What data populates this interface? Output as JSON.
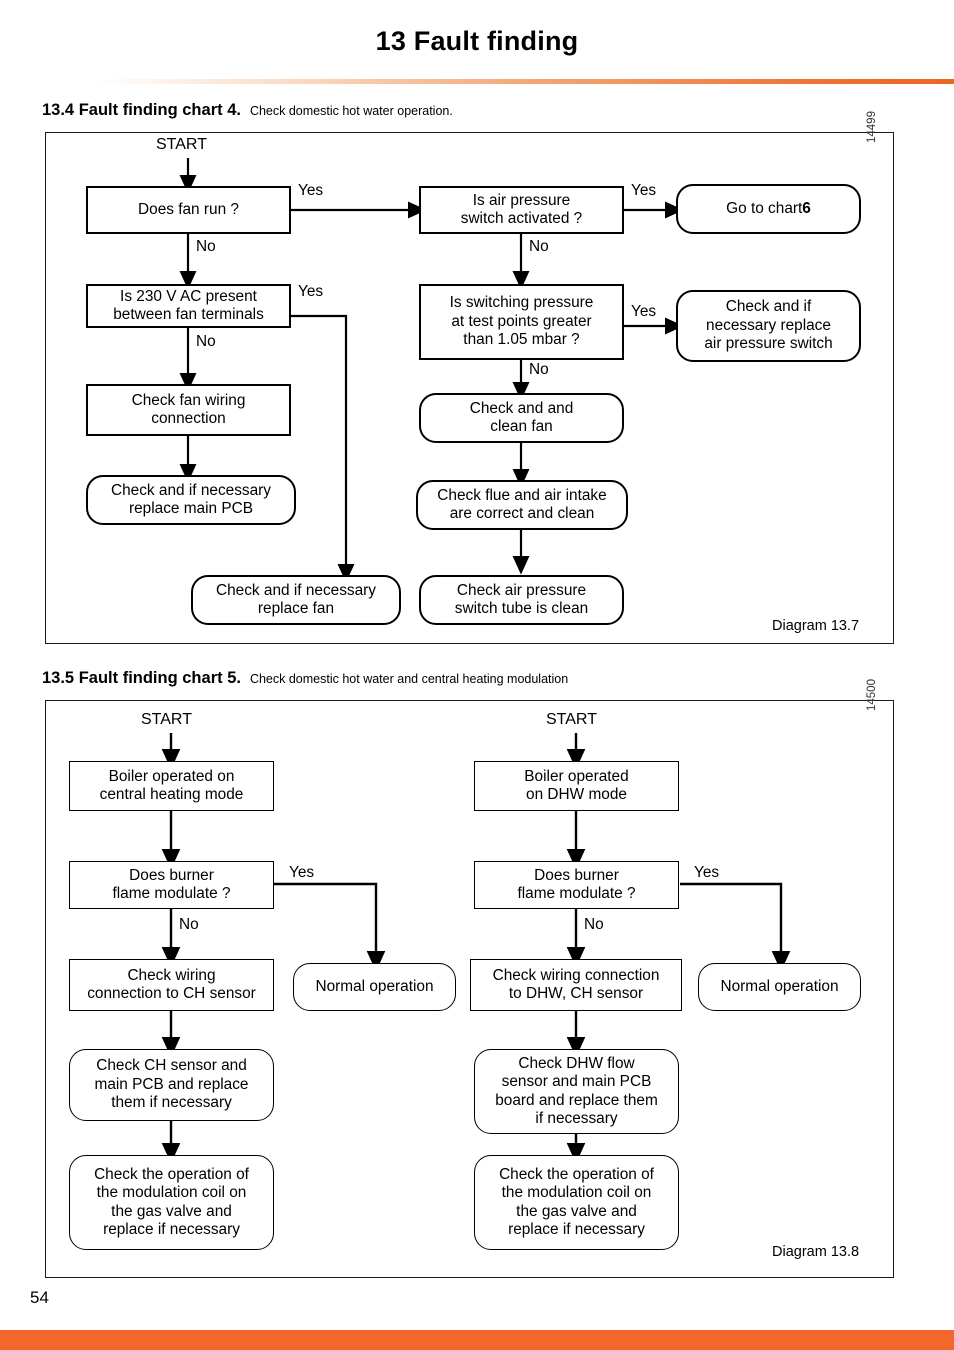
{
  "page": {
    "title": "13  Fault finding",
    "number": "54",
    "accent_color": "#f2672c"
  },
  "sections": [
    {
      "number": "13.4 Fault finding chart 4.",
      "subtitle": "Check domestic hot water operation.",
      "diagram_caption": "Diagram 13.7",
      "id_code": "14499"
    },
    {
      "number": "13.5 Fault finding chart 5.",
      "subtitle": "Check domestic hot water  and  central heating modulation",
      "diagram_caption": "Diagram 13.8",
      "id_code": "14500"
    }
  ],
  "chart4": {
    "start_label": "START",
    "nodes": {
      "fan_run": "Does fan run ?",
      "air_pressure_switch": "Is air pressure\nswitch activated ?",
      "go_to_chart6": "Go to chart ",
      "go_to_chart6_bold": "6",
      "v230": "Is 230 V AC present\nbetween fan terminals",
      "switching_pressure": "Is switching pressure\nat test points greater\nthan 1.05 mbar ?",
      "replace_switch": "Check and if\nnecessary replace\nair pressure switch",
      "fan_wiring": "Check fan wiring\nconnection",
      "clean_fan": "Check and and\nclean fan",
      "replace_pcb": "Check and if necessary\nreplace main PCB",
      "flue_intake": "Check flue and air intake\nare correct and clean",
      "replace_fan": "Check and if necessary\nreplace fan",
      "switch_tube": "Check air pressure\nswitch tube is clean"
    },
    "branch_labels": {
      "fan_run_yes": "Yes",
      "fan_run_no": "No",
      "aps_yes": "Yes",
      "aps_no": "No",
      "v230_yes": "Yes",
      "v230_no": "No",
      "pressure_yes": "Yes",
      "pressure_no": "No"
    }
  },
  "chart5": {
    "left": {
      "start_label": "START",
      "nodes": {
        "boiler_mode": "Boiler operated on\ncentral heating mode",
        "burner_modulate": "Does burner\nflame modulate ?",
        "normal_operation": "Normal operation",
        "check_wiring": "Check wiring\nconnection to CH sensor",
        "check_sensor": "Check CH sensor and\nmain PCB and replace\nthem if necessary",
        "check_modulation": "Check the operation of\nthe modulation coil on\nthe gas valve and\nreplace if necessary"
      },
      "branch_labels": {
        "yes": "Yes",
        "no": "No"
      }
    },
    "right": {
      "start_label": "START",
      "nodes": {
        "boiler_mode": "Boiler operated\non DHW mode",
        "burner_modulate": "Does burner\nflame modulate ?",
        "normal_operation": "Normal operation",
        "check_wiring": "Check wiring connection\nto DHW, CH sensor",
        "check_sensor": "Check DHW flow\nsensor and main PCB\nboard and replace them\nif necessary",
        "check_modulation": "Check the operation of\nthe modulation coil on\nthe gas valve and\nreplace if necessary"
      },
      "branch_labels": {
        "yes": "Yes",
        "no": "No"
      }
    }
  }
}
